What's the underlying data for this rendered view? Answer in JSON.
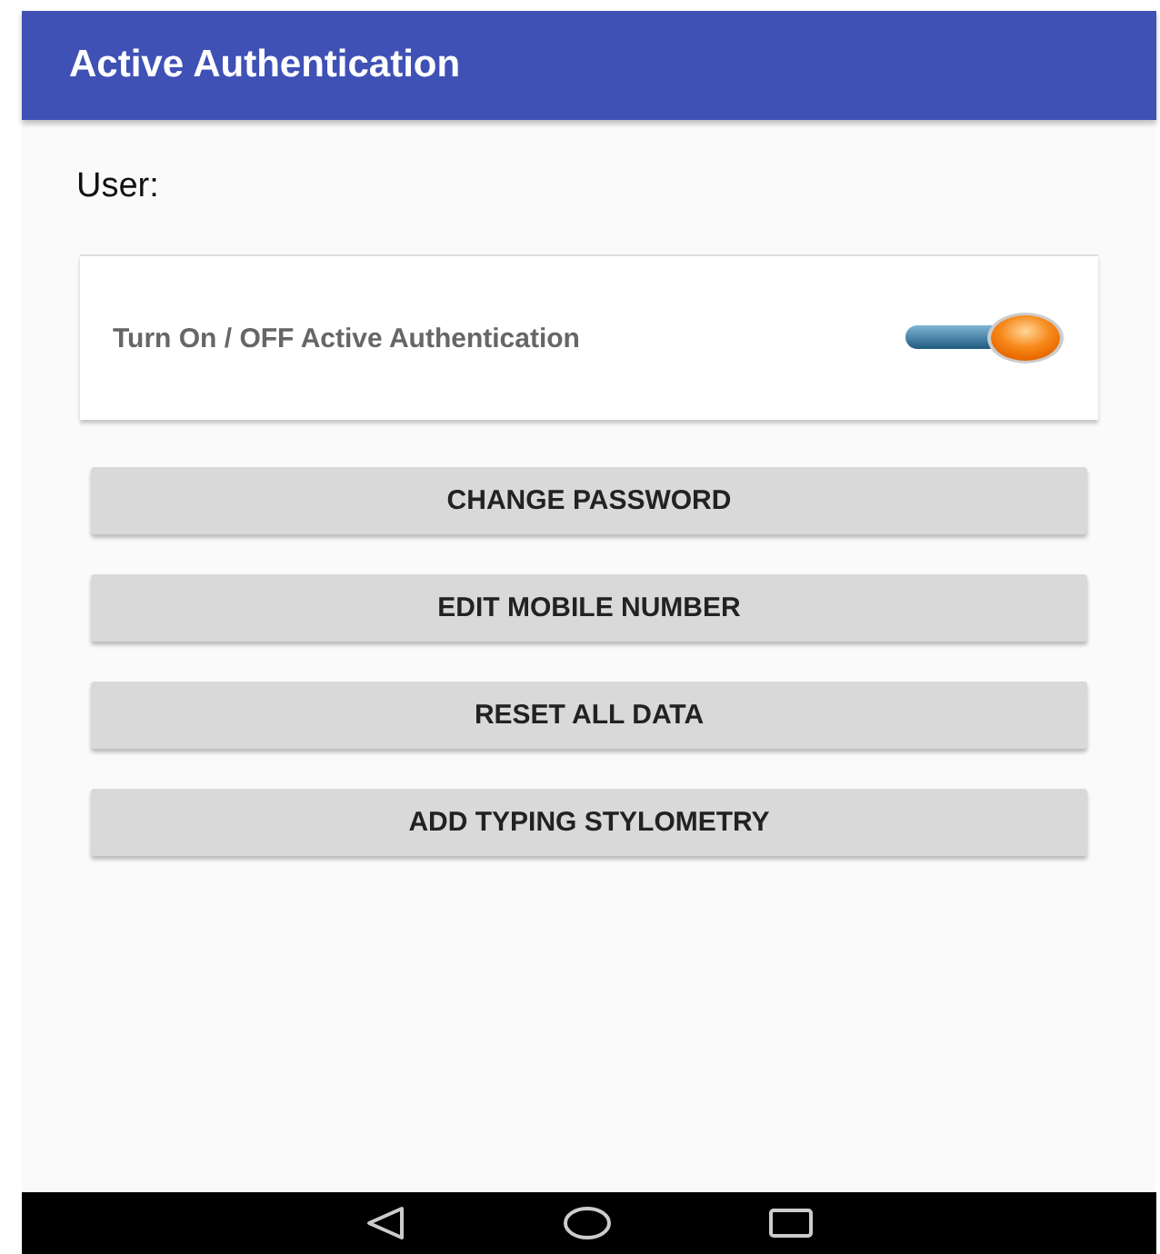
{
  "app_bar": {
    "title": "Active Authentication"
  },
  "user_label": "User:",
  "setting": {
    "label": "Turn On / OFF Active Authentication",
    "on": true
  },
  "buttons": [
    "CHANGE PASSWORD",
    "EDIT MOBILE NUMBER",
    "RESET ALL DATA",
    "ADD TYPING STYLOMETRY"
  ]
}
